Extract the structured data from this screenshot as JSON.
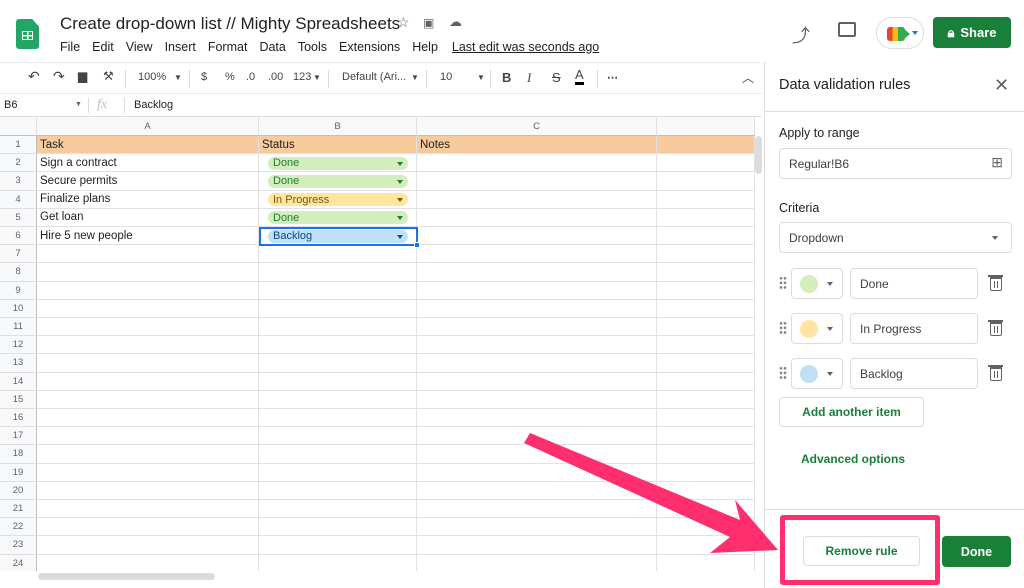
{
  "app": {
    "title": "Create drop-down list // Mighty Spreadsheets",
    "menu": [
      "File",
      "Edit",
      "View",
      "Insert",
      "Format",
      "Data",
      "Tools",
      "Extensions",
      "Help"
    ],
    "last_edit": "Last edit was seconds ago",
    "share_label": "Share"
  },
  "toolbar": {
    "zoom": "100%",
    "currency": "$",
    "percent": "%",
    "dec_decrease": ".0",
    "dec_increase": ".00",
    "more_formats": "123",
    "font": "Default (Ari...",
    "font_size": "10",
    "bold": "B",
    "italic": "I",
    "strike": "S",
    "text_color": "A",
    "more": "⋯"
  },
  "formula_bar": {
    "cell_ref": "B6",
    "fx": "fx",
    "value": "Backlog"
  },
  "sheet": {
    "columns": [
      "A",
      "B",
      "C",
      ""
    ],
    "rows": [
      "1",
      "2",
      "3",
      "4",
      "5",
      "6",
      "7",
      "8",
      "9",
      "10",
      "11",
      "12",
      "13",
      "14",
      "15",
      "16",
      "17",
      "18",
      "19",
      "20",
      "21",
      "22",
      "23",
      "24"
    ],
    "header_row": {
      "a": "Task",
      "b": "Status",
      "c": "Notes"
    },
    "data": [
      {
        "task": "Sign a contract",
        "status": "Done",
        "status_color": "#d4edbc",
        "status_text": "#188038"
      },
      {
        "task": "Secure permits",
        "status": "Done",
        "status_color": "#d4edbc",
        "status_text": "#188038"
      },
      {
        "task": "Finalize plans",
        "status": "In Progress",
        "status_color": "#ffe5a0",
        "status_text": "#7a5a00"
      },
      {
        "task": "Get loan",
        "status": "Done",
        "status_color": "#d4edbc",
        "status_text": "#188038"
      },
      {
        "task": "Hire 5 new people",
        "status": "Backlog",
        "status_color": "#bfe1f6",
        "status_text": "#0b4a8b"
      }
    ],
    "header_color": "#f8cb9c",
    "selected_cell": "B6"
  },
  "panel": {
    "title": "Data validation rules",
    "apply_label": "Apply to range",
    "range_value": "Regular!B6",
    "criteria_label": "Criteria",
    "criteria_value": "Dropdown",
    "items": [
      {
        "label": "Done",
        "color": "#d4edbc"
      },
      {
        "label": "In Progress",
        "color": "#ffe5a0"
      },
      {
        "label": "Backlog",
        "color": "#bfe1f6"
      }
    ],
    "add_item": "Add another item",
    "advanced": "Advanced options",
    "remove_rule": "Remove rule",
    "done": "Done"
  },
  "annotation": {
    "color": "#ff2e6f"
  }
}
